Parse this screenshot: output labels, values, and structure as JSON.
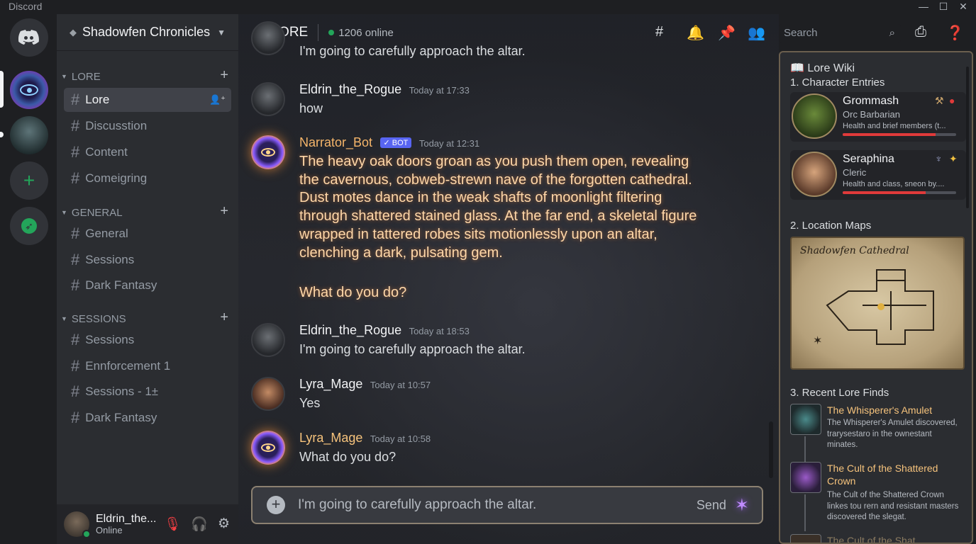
{
  "window": {
    "title": "Discord",
    "minimize": "—",
    "maximize": "☐",
    "close": "✕"
  },
  "server": {
    "name": "Shadowfen Chronicles"
  },
  "categories": [
    {
      "label": "LORE",
      "channels": [
        "Lore",
        "Discusstion",
        "Content",
        "Comeigring"
      ]
    },
    {
      "label": "GENERAL",
      "channels": [
        "General",
        "Sessions",
        "Dark Fantasy"
      ]
    },
    {
      "label": "SESSIONS",
      "channels": [
        "Sessions",
        "Ennforcement 1",
        "Sessions - 1±",
        "Dark Fantasy"
      ]
    }
  ],
  "user": {
    "name": "Eldrin_the...",
    "status": "Online"
  },
  "channel": {
    "name": "LORE",
    "online": "1206 online"
  },
  "search": {
    "placeholder": "Search"
  },
  "messages": [
    {
      "author": "",
      "time": "",
      "text": "I'm going to carefully approach the altar."
    },
    {
      "author": "Eldrin_the_Rogue",
      "time": "Today at 17:33",
      "text": "how"
    },
    {
      "author": "Narrator_Bot",
      "badge": "✓ BOT",
      "time": "Today at 12:31",
      "text": "The heavy oak doors groan as you push them open, revealing the cavernous, cobweb-strewn nave of the forgotten cathedral. Dust motes dance in the weak shafts of moonlight filtering through shattered stained glass. At the far end, a skeletal figure wrapped in tattered robes sits motionlessly upon an altar, clenching a dark, pulsating gem.",
      "text2": "What do you do?"
    },
    {
      "author": "Eldrin_the_Rogue",
      "time": "Today at 18:53",
      "text": "I'm going to carefully approach the altar."
    },
    {
      "author": "Lyra_Mage",
      "time": "Today at 10:57",
      "text": "Yes"
    },
    {
      "author": "Lyra_Mage",
      "time": "Today at 10:58",
      "text": "What do you do?"
    }
  ],
  "composer": {
    "value": "I'm going to carefully approach the altar.",
    "send": "Send"
  },
  "wiki": {
    "title": "Lore Wiki",
    "sec1": "1. Character Entries",
    "chars": [
      {
        "name": "Grommash",
        "class": "Orc Barbarian",
        "desc": "Health and brief members (t...",
        "health": 0.82
      },
      {
        "name": "Seraphina",
        "class": "Cleric",
        "desc": "Health and class, sneon by....",
        "health": 0.73
      }
    ],
    "sec2": "2. Location Maps",
    "map_title": "Shadowfen Cathedral",
    "sec3": "3. Recent Lore Finds",
    "finds": [
      {
        "title": "The Whisperer's Amulet",
        "body": "The Whisperer's Amulet discovered, trarysestaro in the ownestant minates."
      },
      {
        "title": "The Cult of the Shattered Crown",
        "body": "The Cult of the Shattered Crown linkes tou rern and resistant masters discovered the slegat."
      },
      {
        "title": "The Cult of the Shat",
        "body": ""
      }
    ]
  }
}
